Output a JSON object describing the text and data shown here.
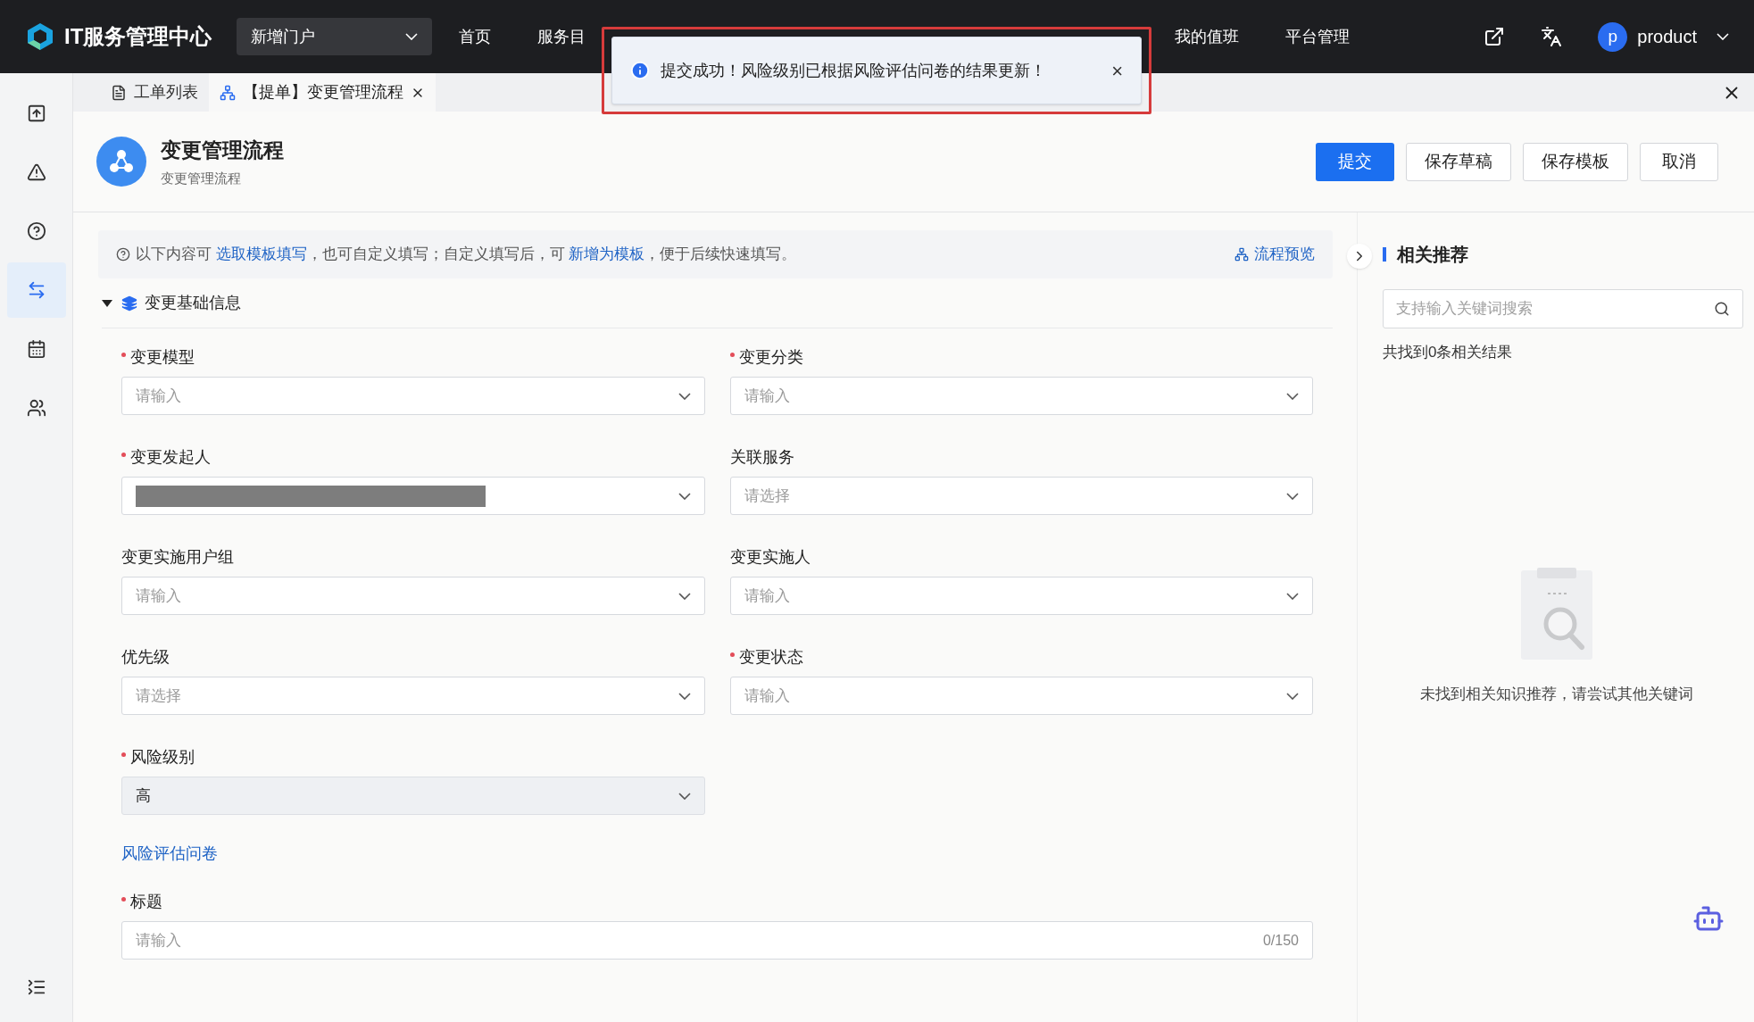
{
  "app": {
    "title": "IT服务管理中心",
    "portal": "新增门户"
  },
  "nav": [
    {
      "label": "首页",
      "selected": false
    },
    {
      "label": "服务目",
      "selected": false
    },
    {
      "label": "我的值班",
      "selected": false
    },
    {
      "label": "平台管理",
      "selected": false
    }
  ],
  "user": {
    "avatar": "p",
    "name": "product"
  },
  "toast": {
    "message": "提交成功！风险级别已根据风险评估问卷的结果更新！",
    "close": "×"
  },
  "sidebar": [
    {
      "selected": false
    },
    {
      "selected": false
    },
    {
      "selected": false
    },
    {
      "selected": true
    },
    {
      "selected": false
    },
    {
      "selected": false
    }
  ],
  "tabs": [
    {
      "label": "工单列表",
      "selected": false,
      "closable": false
    },
    {
      "label": "【提单】变更管理流程",
      "selected": true,
      "closable": true
    }
  ],
  "header": {
    "title": "变更管理流程",
    "subtitle": "变更管理流程",
    "buttons": [
      {
        "label": "提交",
        "primary": true
      },
      {
        "label": "保存草稿",
        "primary": false
      },
      {
        "label": "保存模板",
        "primary": false
      },
      {
        "label": "取消",
        "primary": false
      }
    ]
  },
  "hint": {
    "parts": [
      {
        "text": "以下内容可 ",
        "link": false
      },
      {
        "text": "选取模板填写",
        "link": true
      },
      {
        "text": "，也可自定义填写；自定义填写后，可 ",
        "link": false
      },
      {
        "text": "新增为模板",
        "link": true
      },
      {
        "text": "，便于后续快速填写。",
        "link": false
      }
    ],
    "preview": "流程预览"
  },
  "section": {
    "title": "变更基础信息",
    "expanded": true
  },
  "fields": [
    {
      "label": "变更模型",
      "required": true,
      "kind": "select",
      "placeholder": "请输入"
    },
    {
      "label": "变更分类",
      "required": true,
      "kind": "select",
      "placeholder": "请输入"
    },
    {
      "label": "变更发起人",
      "required": true,
      "kind": "redacted"
    },
    {
      "label": "关联服务",
      "required": false,
      "kind": "select",
      "placeholder": "请选择"
    },
    {
      "label": "变更实施用户组",
      "required": false,
      "kind": "select",
      "placeholder": "请输入"
    },
    {
      "label": "变更实施人",
      "required": false,
      "kind": "select",
      "placeholder": "请输入"
    },
    {
      "label": "优先级",
      "required": false,
      "kind": "select",
      "placeholder": "请选择"
    },
    {
      "label": "变更状态",
      "required": true,
      "kind": "select",
      "placeholder": "请输入"
    },
    {
      "label": "风险级别",
      "required": true,
      "kind": "select",
      "value": "高"
    }
  ],
  "questionnaire_link": "风险评估问卷",
  "title_field": {
    "label": "标题",
    "required": true,
    "placeholder": "请输入",
    "counter": "0/150"
  },
  "related": {
    "title": "相关推荐",
    "search_placeholder": "支持输入关键词搜索",
    "count": "共找到0条相关结果",
    "empty": "未找到相关知识推荐，请尝试其他关键词"
  }
}
